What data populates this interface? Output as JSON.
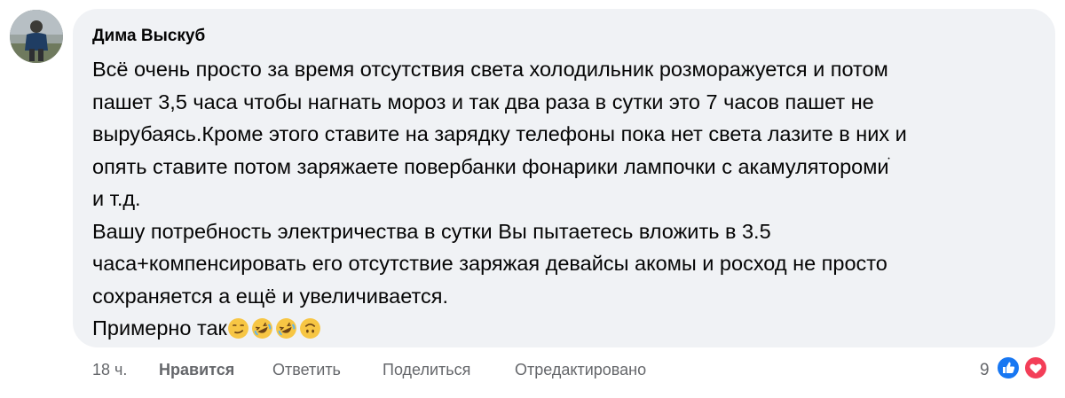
{
  "comment": {
    "author": "Дима Выскуб",
    "lines": [
      "Всё очень просто за время отсутствия света холодильник розморажуется и потом",
      "пашет 3,5 часа чтобы нагнать мороз и так два раза в сутки это 7 часов пашет не",
      "вырубаясь.Кроме этого ставите на зарядку телефоны пока нет света лазите в них и",
      "опять ставите потом заряжаете повербанки фонарики лампочки с акамуляторомиֹ",
      "и т.д.",
      "Вашу потребность электричества в сутки Вы пытаетесь вложить в 3.5",
      "часа+компенсировать его отсутствие заряжая девайсы акомы и росход не просто",
      "сохраняется а ещё и увеличивается.",
      "Примерно так"
    ],
    "trailing_emojis": [
      "smirk-face-icon",
      "rofl-face-icon",
      "rofl-face-icon",
      "upside-down-face-icon"
    ]
  },
  "actions": {
    "time": "18 ч.",
    "like": "Нравится",
    "reply": "Ответить",
    "share": "Поделиться",
    "edited": "Отредактировано"
  },
  "reactions": {
    "count": "9",
    "types": [
      "like-reaction-icon",
      "love-reaction-icon"
    ],
    "colors": {
      "like": "#1877f2",
      "love": "#f33e58"
    }
  }
}
